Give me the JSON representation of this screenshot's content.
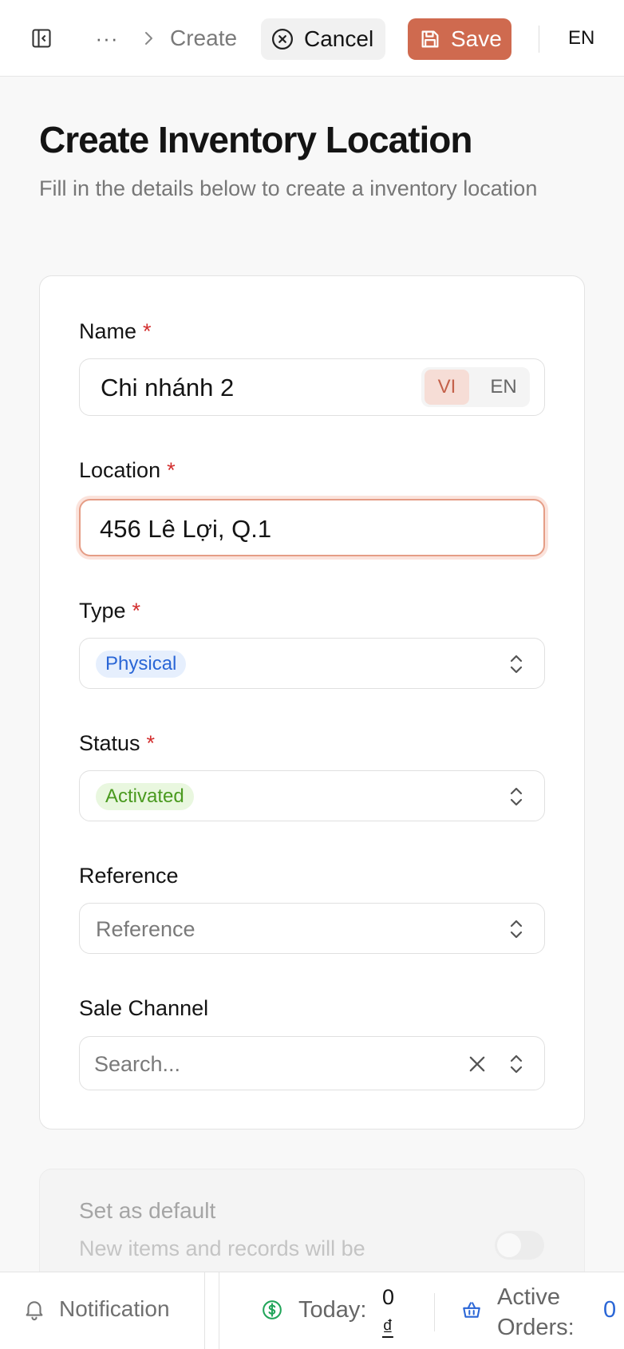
{
  "header": {
    "breadcrumb_more": "···",
    "breadcrumb_current": "Create",
    "cancel_label": "Cancel",
    "save_label": "Save",
    "language": "EN"
  },
  "page": {
    "title": "Create Inventory Location",
    "subtitle": "Fill in the details below to create a inventory location"
  },
  "form": {
    "name": {
      "label": "Name",
      "required_mark": "*",
      "value": "Chi nhánh 2",
      "lang_active": "VI",
      "lang_other": "EN"
    },
    "location": {
      "label": "Location",
      "required_mark": "*",
      "value": "456 Lê Lợi, Q.1"
    },
    "type": {
      "label": "Type",
      "required_mark": "*",
      "value": "Physical"
    },
    "status": {
      "label": "Status",
      "required_mark": "*",
      "value": "Activated"
    },
    "reference": {
      "label": "Reference",
      "placeholder": "Reference"
    },
    "sale_channel": {
      "label": "Sale Channel",
      "placeholder": "Search..."
    }
  },
  "default_section": {
    "title": "Set as default",
    "description": "New items and records will be",
    "enabled": false
  },
  "footer": {
    "notification_label": "Notification",
    "today_label": "Today:",
    "today_value": "0",
    "today_currency": "₫",
    "active_orders_label": "Active Orders:",
    "active_orders_value": "0"
  },
  "colors": {
    "primary": "#cf6a4f",
    "required": "#d32f2f",
    "type_badge": "#2a66d6",
    "status_badge": "#4a9a1f"
  }
}
